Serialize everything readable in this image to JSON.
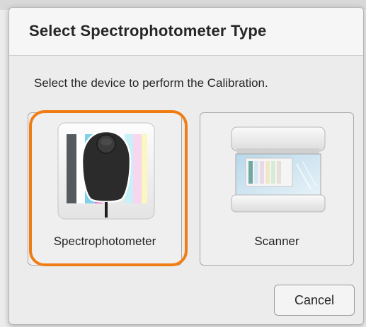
{
  "dialog": {
    "title": "Select Spectrophotometer Type",
    "instruction": "Select the device to perform the Calibration.",
    "accent_color": "#f07d14"
  },
  "devices": [
    {
      "label": "Spectrophotometer",
      "icon": "spectrophotometer-icon",
      "selected": true
    },
    {
      "label": "Scanner",
      "icon": "scanner-icon",
      "selected": false
    }
  ],
  "buttons": {
    "cancel_label": "Cancel"
  }
}
